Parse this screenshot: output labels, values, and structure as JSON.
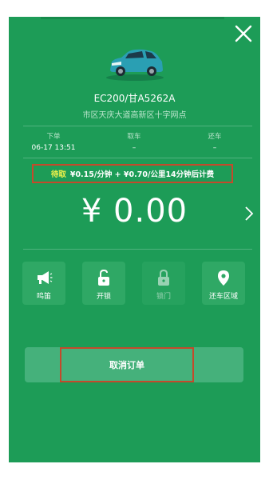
{
  "close_icon": "close-icon",
  "vehicle": {
    "plate": "EC200/甘A5262A",
    "station": "市区天庆大道高新区十字网点"
  },
  "trip": [
    {
      "label": "下单",
      "value": "06-17 13:51"
    },
    {
      "label": "取车",
      "value": "–"
    },
    {
      "label": "还车",
      "value": "–"
    }
  ],
  "fee": {
    "tag": "待取",
    "text": "¥0.15/分钟 + ¥0.70/公里14分钟后计费"
  },
  "amount": "¥ 0.00",
  "actions": [
    {
      "label": "鸣笛",
      "icon": "horn-icon",
      "enabled": true
    },
    {
      "label": "开锁",
      "icon": "unlock-icon",
      "enabled": true
    },
    {
      "label": "锁门",
      "icon": "lock-icon",
      "enabled": false
    },
    {
      "label": "还车区域",
      "icon": "location-pin-icon",
      "enabled": true
    }
  ],
  "cancel_label": "取消订单",
  "colors": {
    "panel": "#1d9c57",
    "highlight_border": "#c44a2b",
    "tag": "#f3f34a"
  }
}
